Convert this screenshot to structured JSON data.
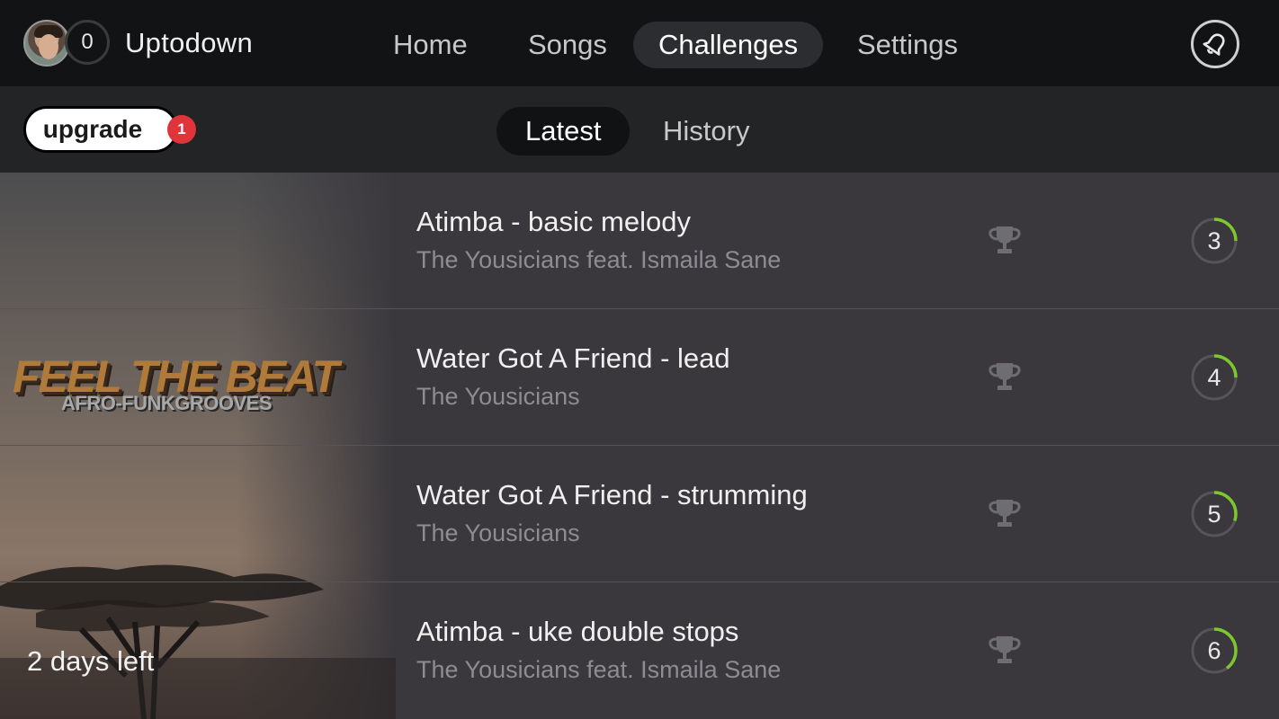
{
  "header": {
    "level": "0",
    "username": "Uptodown",
    "nav": [
      {
        "label": "Home"
      },
      {
        "label": "Songs"
      },
      {
        "label": "Challenges",
        "active": true
      },
      {
        "label": "Settings"
      }
    ],
    "notification_icon": "bell-icon"
  },
  "subbar": {
    "upgrade_label": "upgrade",
    "upgrade_badge": "1",
    "tabs": [
      {
        "label": "Latest",
        "active": true
      },
      {
        "label": "History"
      }
    ]
  },
  "challenge_art": {
    "title": "FEEL THE BEAT",
    "subtitle": "AFRO-FUNKGROOVES",
    "days_left": "2 days left"
  },
  "challenges": [
    {
      "title": "Atimba - basic melody",
      "artist": "The Yousicians feat. Ismaila Sane",
      "level": "3",
      "progress": 0.25
    },
    {
      "title": "Water Got A Friend - lead",
      "artist": "The Yousicians",
      "level": "4",
      "progress": 0.25
    },
    {
      "title": "Water Got A Friend - strumming",
      "artist": "The Yousicians",
      "level": "5",
      "progress": 0.3
    },
    {
      "title": "Atimba - uke double stops",
      "artist": "The Yousicians feat. Ismaila Sane",
      "level": "6",
      "progress": 0.4
    }
  ],
  "colors": {
    "accent_green": "#7cc72e",
    "progress_track": "#555458",
    "badge_red": "#e0343b",
    "trophy": "#6e6d71"
  }
}
